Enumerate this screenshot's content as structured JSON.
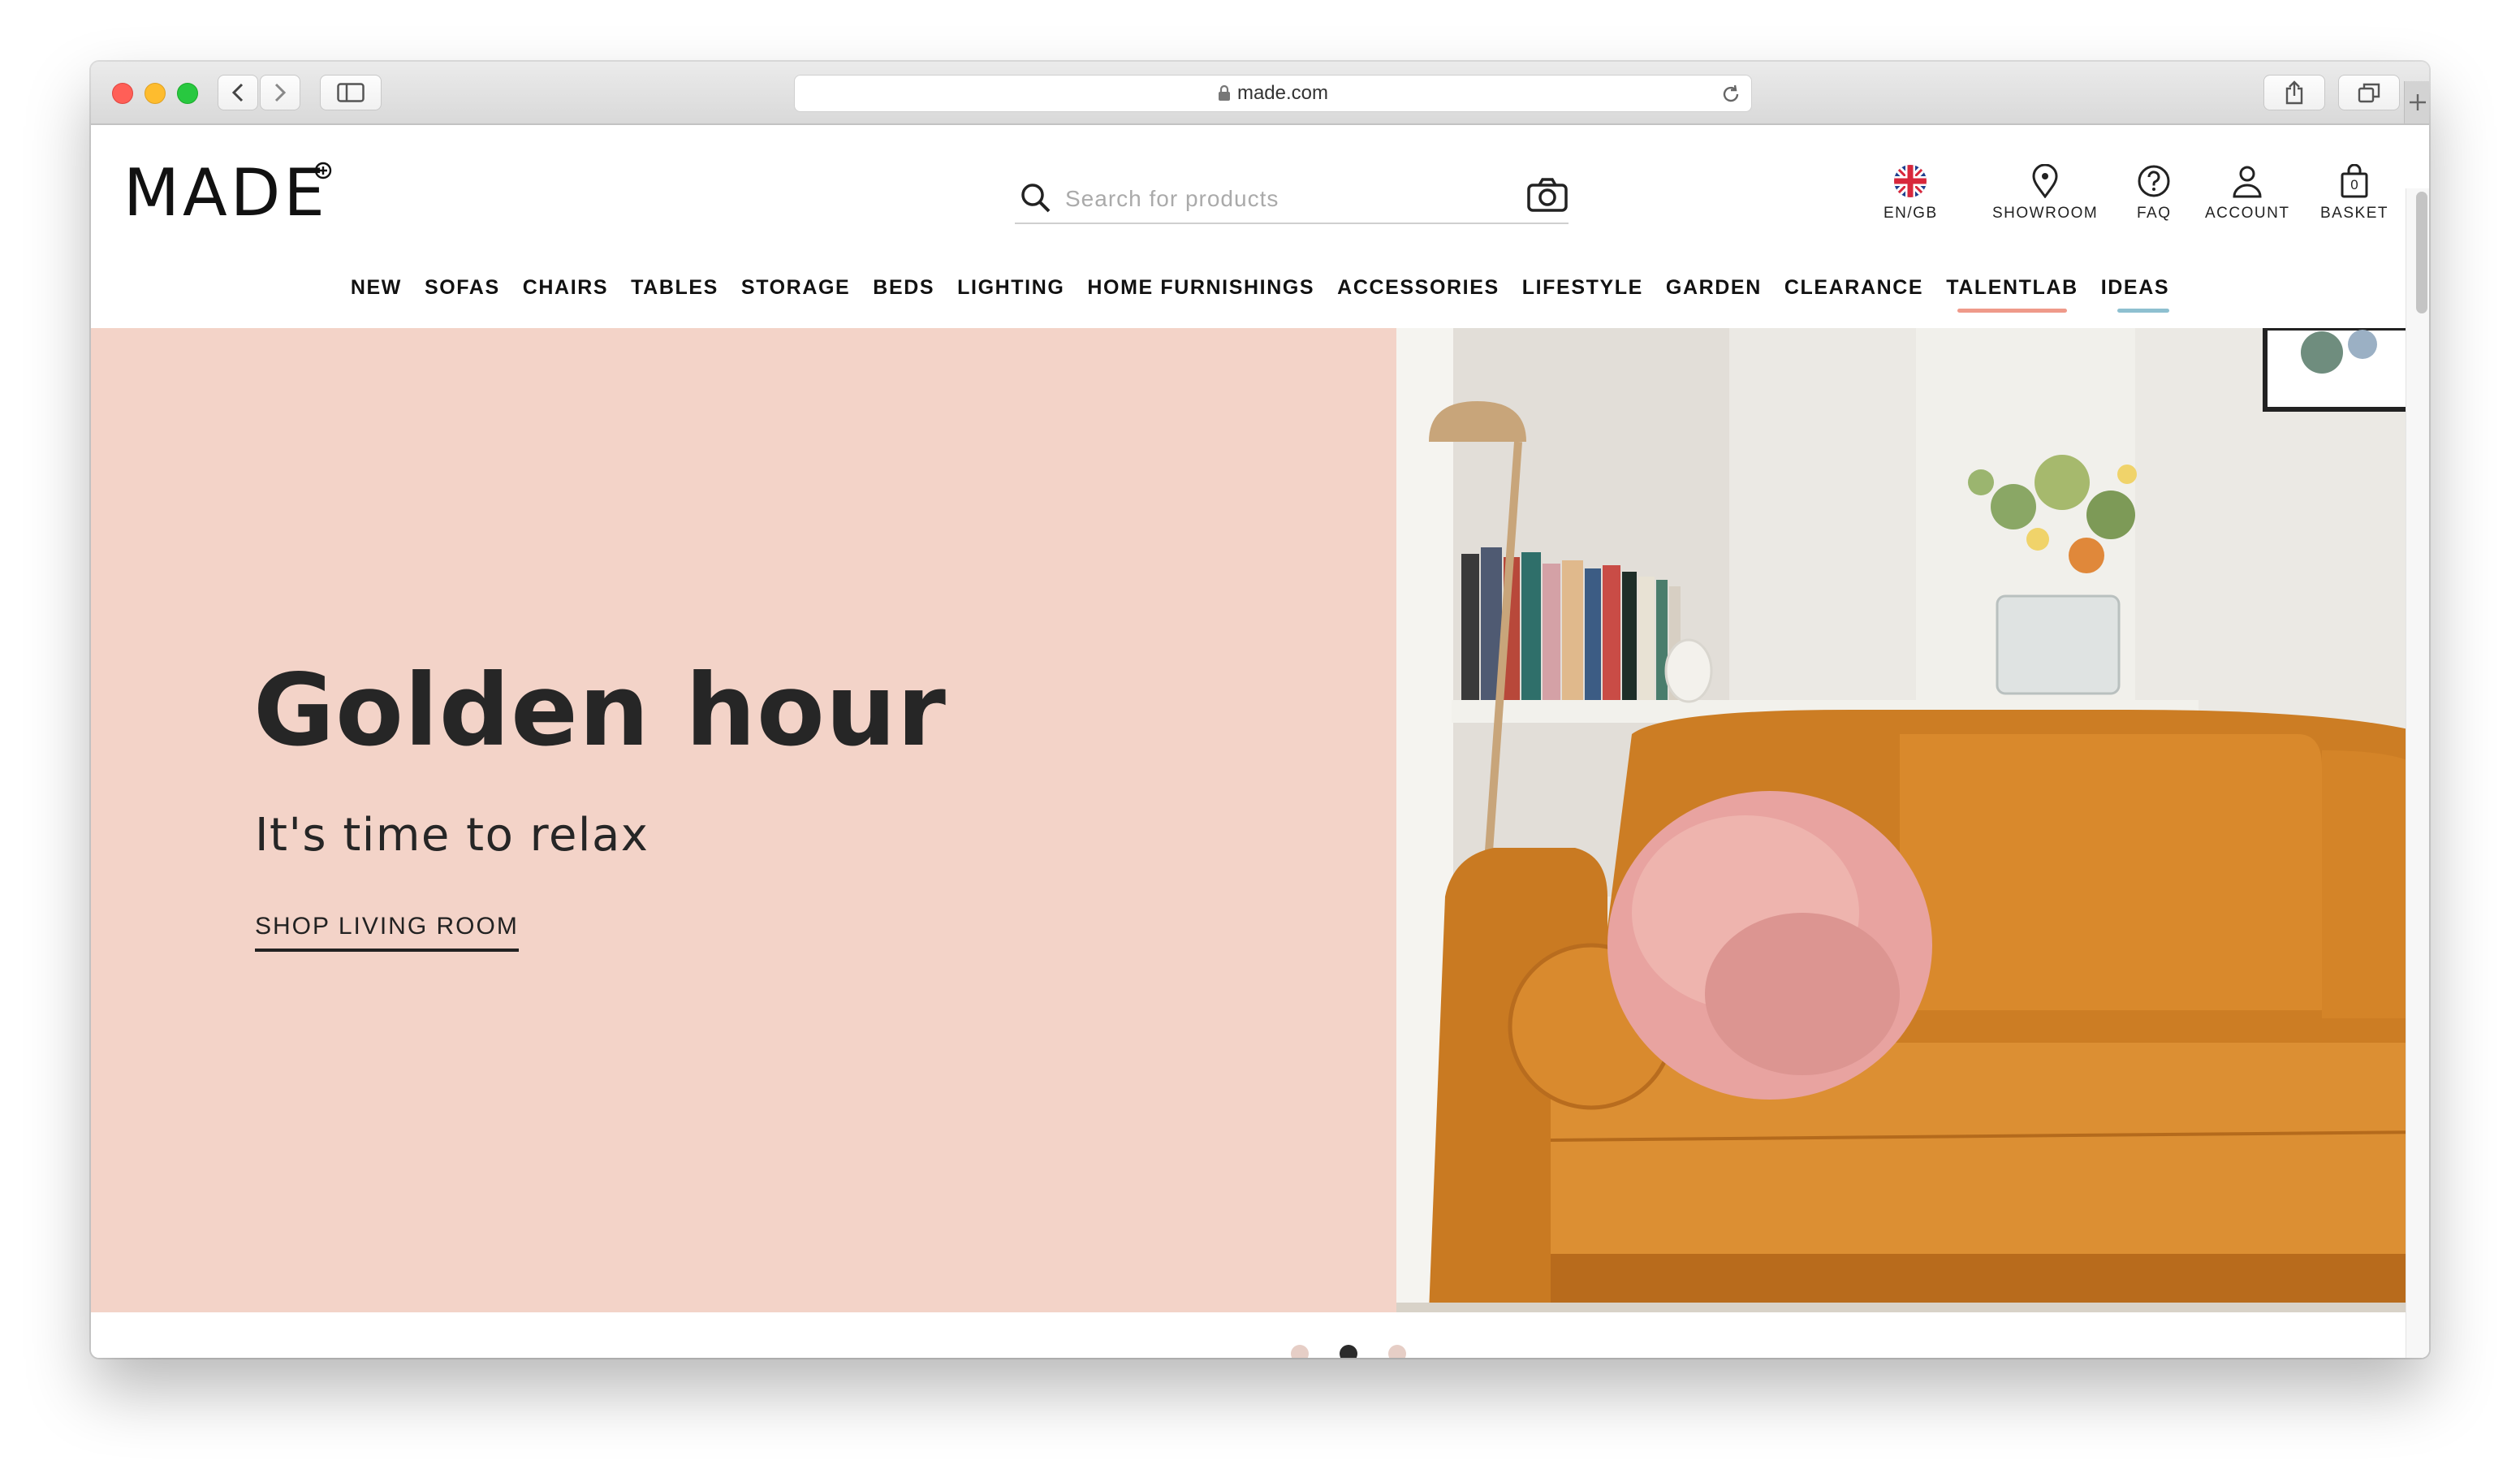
{
  "browser": {
    "url": "made.com",
    "icons": [
      "back-icon",
      "forward-icon",
      "sidebar-icon",
      "lock-icon",
      "reload-icon",
      "share-icon",
      "tabs-icon",
      "plus-icon"
    ]
  },
  "header": {
    "logo": "MADE",
    "search": {
      "placeholder": "Search for products"
    },
    "utilities": {
      "locale": "EN/GB",
      "showroom": "SHOWROOM",
      "faq": "FAQ",
      "account": "ACCOUNT",
      "basket": "BASKET",
      "basket_count": "0"
    }
  },
  "nav": {
    "items": [
      "NEW",
      "SOFAS",
      "CHAIRS",
      "TABLES",
      "STORAGE",
      "BEDS",
      "LIGHTING",
      "HOME FURNISHINGS",
      "ACCESSORIES",
      "LIFESTYLE",
      "GARDEN",
      "CLEARANCE",
      "TALENTLAB",
      "IDEAS"
    ]
  },
  "hero": {
    "title": "Golden hour",
    "subtitle": "It's time to relax",
    "cta": "SHOP LIVING ROOM",
    "carousel": {
      "slides": 3,
      "active": 2
    },
    "colors": {
      "panel": "#f3d3c8",
      "sofa": "#d9892c",
      "cushion": "#e8a3a0"
    }
  }
}
